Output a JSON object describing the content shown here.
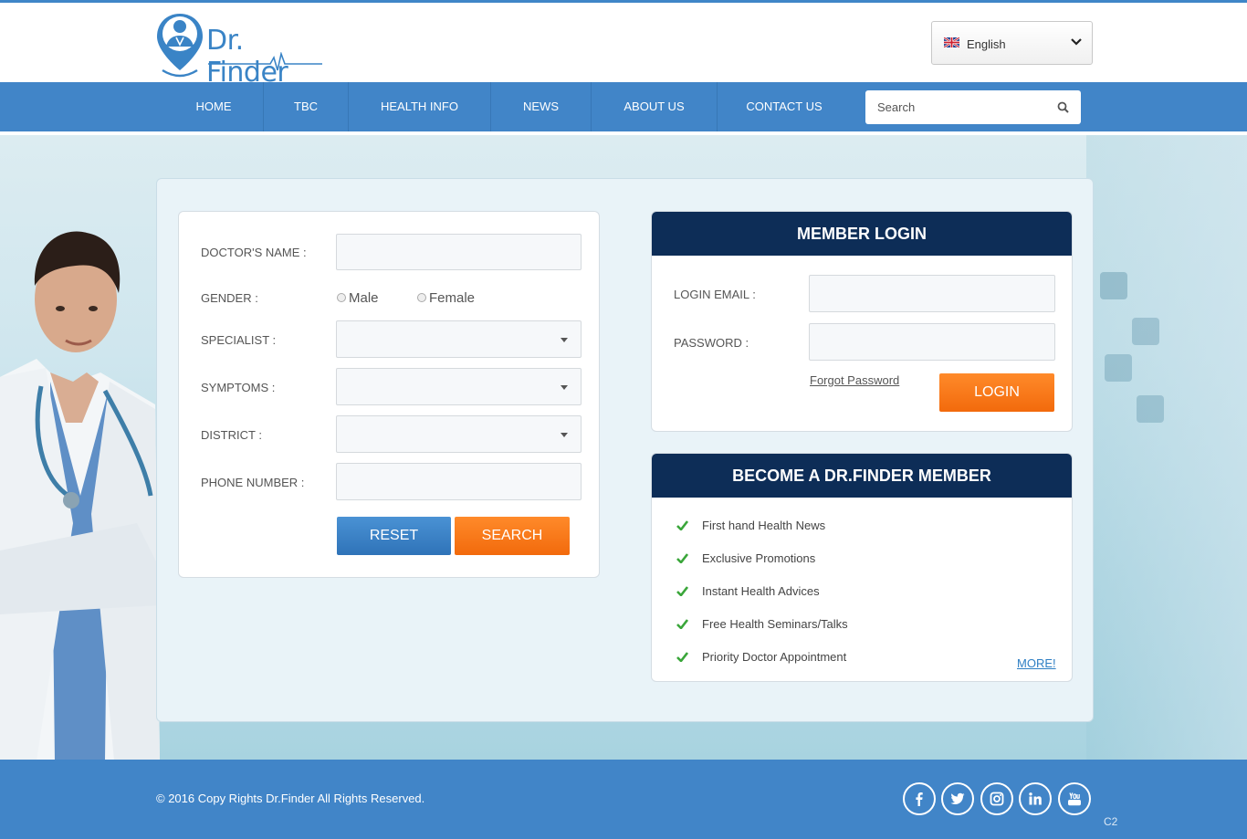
{
  "header": {
    "brand": "Dr. Finder",
    "language": "English"
  },
  "nav": {
    "items": [
      "HOME",
      "TBC",
      "HEALTH INFO",
      "NEWS",
      "ABOUT US",
      "CONTACT US"
    ],
    "search_placeholder": "Search"
  },
  "search_form": {
    "doctor_name_label": "DOCTOR'S NAME  :",
    "gender_label": "GENDER :",
    "gender_options": [
      "Male",
      "Female"
    ],
    "specialist_label": "SPECIALIST :",
    "symptoms_label": "SYMPTOMS :",
    "district_label": "DISTRICT :",
    "phone_label": "PHONE NUMBER :",
    "reset_label": "RESET",
    "search_label": "SEARCH"
  },
  "login": {
    "title": "MEMBER LOGIN",
    "email_label": "LOGIN EMAIL :",
    "password_label": "PASSWORD :",
    "forgot_label": "Forgot Password",
    "login_label": "LOGIN"
  },
  "membership": {
    "title": "BECOME A DR.FINDER MEMBER",
    "benefits": [
      "First hand Health News",
      "Exclusive Promotions",
      "Instant Health Advices",
      "Free Health Seminars/Talks",
      "Priority Doctor Appointment"
    ],
    "more_label": "MORE!"
  },
  "footer": {
    "copyright": "© 2016 Copy Rights Dr.Finder All Rights Reserved.",
    "code": "C2",
    "social": [
      "facebook-icon",
      "twitter-icon",
      "instagram-icon",
      "linkedin-icon",
      "youtube-icon"
    ]
  },
  "colors": {
    "nav_blue": "#4185c8",
    "card_header_navy": "#0d2d57",
    "accent_orange": "#f26a0c",
    "button_blue": "#2f73b8",
    "check_green": "#3aa63a"
  }
}
